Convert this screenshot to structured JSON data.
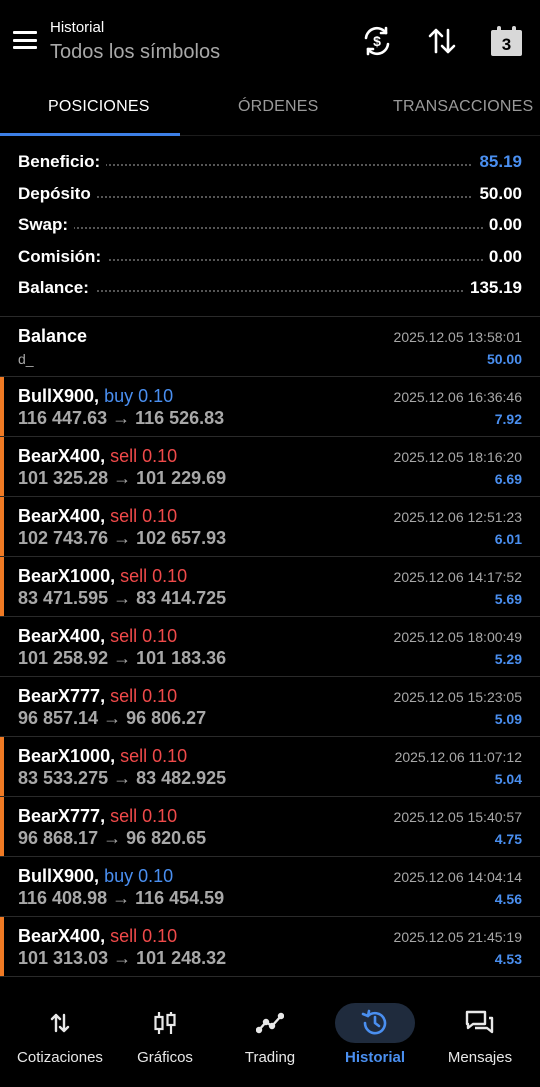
{
  "header": {
    "title": "Historial",
    "subtitle": "Todos los símbolos",
    "calendar_day": "3",
    "icons": [
      "menu-icon",
      "currency-exchange-icon",
      "sort-icon",
      "calendar-icon"
    ]
  },
  "tabs": [
    {
      "label": "POSICIONES",
      "active": true
    },
    {
      "label": "ÓRDENES",
      "active": false
    },
    {
      "label": "TRANSACCIONES",
      "active": false
    }
  ],
  "summary": [
    {
      "label": "Beneficio:",
      "value": "85.19",
      "highlight": true
    },
    {
      "label": "Depósito",
      "value": "50.00",
      "highlight": false
    },
    {
      "label": "Swap:",
      "value": "0.00",
      "highlight": false
    },
    {
      "label": "Comisión:",
      "value": "0.00",
      "highlight": false
    },
    {
      "label": "Balance:",
      "value": "135.19",
      "highlight": false
    }
  ],
  "balance_entry": {
    "title": "Balance",
    "comment": "d_",
    "time": "2025.12.05 13:58:01",
    "amount": "50.00"
  },
  "positions": [
    {
      "symbol": "BullX900,",
      "side": "buy 0.10",
      "type": "buy",
      "prices": "116 447.63 → 116 526.83",
      "time": "2025.12.06 16:36:46",
      "profit": "7.92",
      "marked": true
    },
    {
      "symbol": "BearX400,",
      "side": "sell 0.10",
      "type": "sell",
      "prices": "101 325.28 → 101 229.69",
      "time": "2025.12.05 18:16:20",
      "profit": "6.69",
      "marked": true
    },
    {
      "symbol": "BearX400,",
      "side": "sell 0.10",
      "type": "sell",
      "prices": "102 743.76 → 102 657.93",
      "time": "2025.12.06 12:51:23",
      "profit": "6.01",
      "marked": true
    },
    {
      "symbol": "BearX1000,",
      "side": "sell 0.10",
      "type": "sell",
      "prices": "83 471.595 → 83 414.725",
      "time": "2025.12.06 14:17:52",
      "profit": "5.69",
      "marked": true
    },
    {
      "symbol": "BearX400,",
      "side": "sell 0.10",
      "type": "sell",
      "prices": "101 258.92 → 101 183.36",
      "time": "2025.12.05 18:00:49",
      "profit": "5.29",
      "marked": false
    },
    {
      "symbol": "BearX777,",
      "side": "sell 0.10",
      "type": "sell",
      "prices": "96 857.14 → 96 806.27",
      "time": "2025.12.05 15:23:05",
      "profit": "5.09",
      "marked": false
    },
    {
      "symbol": "BearX1000,",
      "side": "sell 0.10",
      "type": "sell",
      "prices": "83 533.275 → 83 482.925",
      "time": "2025.12.06 11:07:12",
      "profit": "5.04",
      "marked": true
    },
    {
      "symbol": "BearX777,",
      "side": "sell 0.10",
      "type": "sell",
      "prices": "96 868.17 → 96 820.65",
      "time": "2025.12.05 15:40:57",
      "profit": "4.75",
      "marked": true
    },
    {
      "symbol": "BullX900,",
      "side": "buy 0.10",
      "type": "buy",
      "prices": "116 408.98 → 116 454.59",
      "time": "2025.12.06 14:04:14",
      "profit": "4.56",
      "marked": false
    },
    {
      "symbol": "BearX400,",
      "side": "sell 0.10",
      "type": "sell",
      "prices": "101 313.03 → 101 248.32",
      "time": "2025.12.05 21:45:19",
      "profit": "4.53",
      "marked": true
    }
  ],
  "bottom_nav": [
    {
      "label": "Cotizaciones",
      "icon": "quotes-icon",
      "active": false
    },
    {
      "label": "Gráficos",
      "icon": "chart-candles-icon",
      "active": false
    },
    {
      "label": "Trading",
      "icon": "trading-icon",
      "active": false
    },
    {
      "label": "Historial",
      "icon": "history-icon",
      "active": true
    },
    {
      "label": "Mensajes",
      "icon": "messages-icon",
      "active": false
    }
  ],
  "colors": {
    "accent": "#4a8ff0",
    "sell": "#f04a4a",
    "marker": "#f07a24",
    "background": "#000000"
  }
}
